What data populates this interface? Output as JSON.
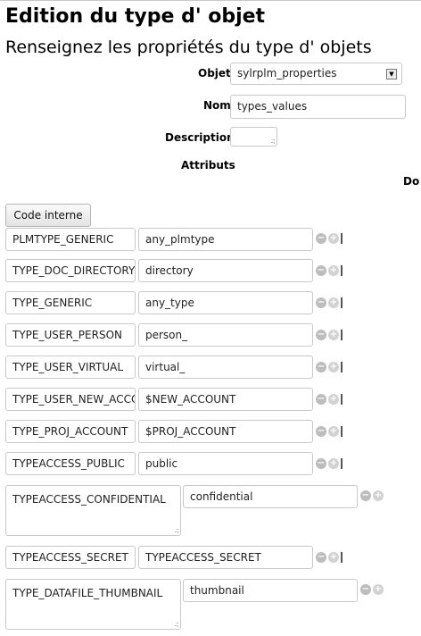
{
  "page": {
    "title": "Edition du type d' objet",
    "subtitle": "Renseignez les propriétés du type d' objets"
  },
  "form": {
    "objet_label": "Objet",
    "objet_value": "sylrplm_properties",
    "nom_label": "Nom",
    "nom_value": "types_values",
    "description_label": "Description",
    "description_value": "",
    "attributs_label": "Attributs",
    "cut_label": "Do",
    "code_interne_button": "Code interne"
  },
  "attributes": [
    {
      "key": "PLMTYPE_GENERIC",
      "value": "any_plmtype"
    },
    {
      "key": "TYPE_DOC_DIRECTORY",
      "value": "directory"
    },
    {
      "key": "TYPE_GENERIC",
      "value": "any_type"
    },
    {
      "key": "TYPE_USER_PERSON",
      "value": "person_"
    },
    {
      "key": "TYPE_USER_VIRTUAL",
      "value": "virtual_"
    },
    {
      "key": "TYPE_USER_NEW_ACCOUNT",
      "value": "$NEW_ACCOUNT"
    },
    {
      "key": "TYPE_PROJ_ACCOUNT",
      "value": "$PROJ_ACCOUNT"
    },
    {
      "key": "TYPEACCESS_PUBLIC",
      "value": "public"
    },
    {
      "key": "TYPEACCESS_CONFIDENTIAL",
      "value": "confidential"
    },
    {
      "key": "TYPEACCESS_SECRET",
      "value": "TYPEACCESS_SECRET"
    },
    {
      "key": "TYPE_DATAFILE_THUMBNAIL",
      "value": "thumbnail"
    }
  ],
  "icons": {
    "remove": "minus-circle-icon",
    "add": "plus-circle-icon"
  }
}
